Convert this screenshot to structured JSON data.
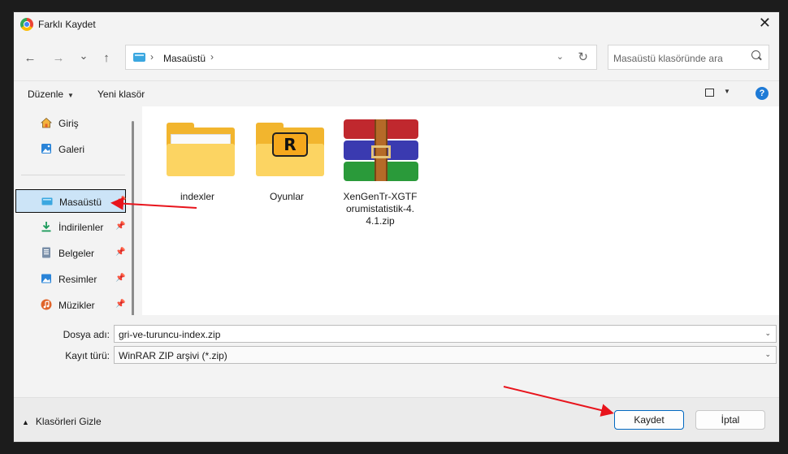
{
  "window": {
    "title": "Farklı Kaydet",
    "close": "✕"
  },
  "nav": {
    "back": "←",
    "forward": "→",
    "recent": "⌄",
    "up": "↑",
    "breadcrumb_sep": "›",
    "location": "Masaüstü",
    "address_dropdown": "⌄",
    "refresh": "↻",
    "search_placeholder": "Masaüstü klasöründe ara"
  },
  "toolbar": {
    "organize": "Düzenle",
    "new_folder": "Yeni klasör",
    "caret": "▼",
    "help": "?"
  },
  "sidebar": {
    "pin_glyph": "📌",
    "items": [
      {
        "label": "Giriş",
        "icon": "home-icon"
      },
      {
        "label": "Galeri",
        "icon": "gallery-icon"
      },
      {
        "label": "Masaüstü",
        "icon": "desktop-icon",
        "selected": true
      },
      {
        "label": "İndirilenler",
        "icon": "download-icon"
      },
      {
        "label": "Belgeler",
        "icon": "documents-icon"
      },
      {
        "label": "Resimler",
        "icon": "pictures-icon"
      },
      {
        "label": "Müzikler",
        "icon": "music-icon"
      }
    ]
  },
  "files": [
    {
      "name": "indexler",
      "type": "folder"
    },
    {
      "name": "Oyunlar",
      "type": "folder"
    },
    {
      "name": "XenGenTr-XGTForumistatistik-4.4.1.zip",
      "type": "winrar-archive"
    }
  ],
  "rockstar_letter": "R",
  "form": {
    "filename_label": "Dosya adı:",
    "filename_value": "gri-ve-turuncu-index.zip",
    "filetype_label": "Kayıt türü:",
    "filetype_value": "WinRAR ZIP arşivi (*.zip)",
    "chevron": "⌄"
  },
  "footer": {
    "hide_folders": "Klasörleri Gizle",
    "hide_caret": "▲",
    "save": "Kaydet",
    "cancel": "İptal"
  },
  "colors": {
    "accent": "#0067c0",
    "annotation_arrow": "#e8141c",
    "folder": "#f2b52e"
  }
}
